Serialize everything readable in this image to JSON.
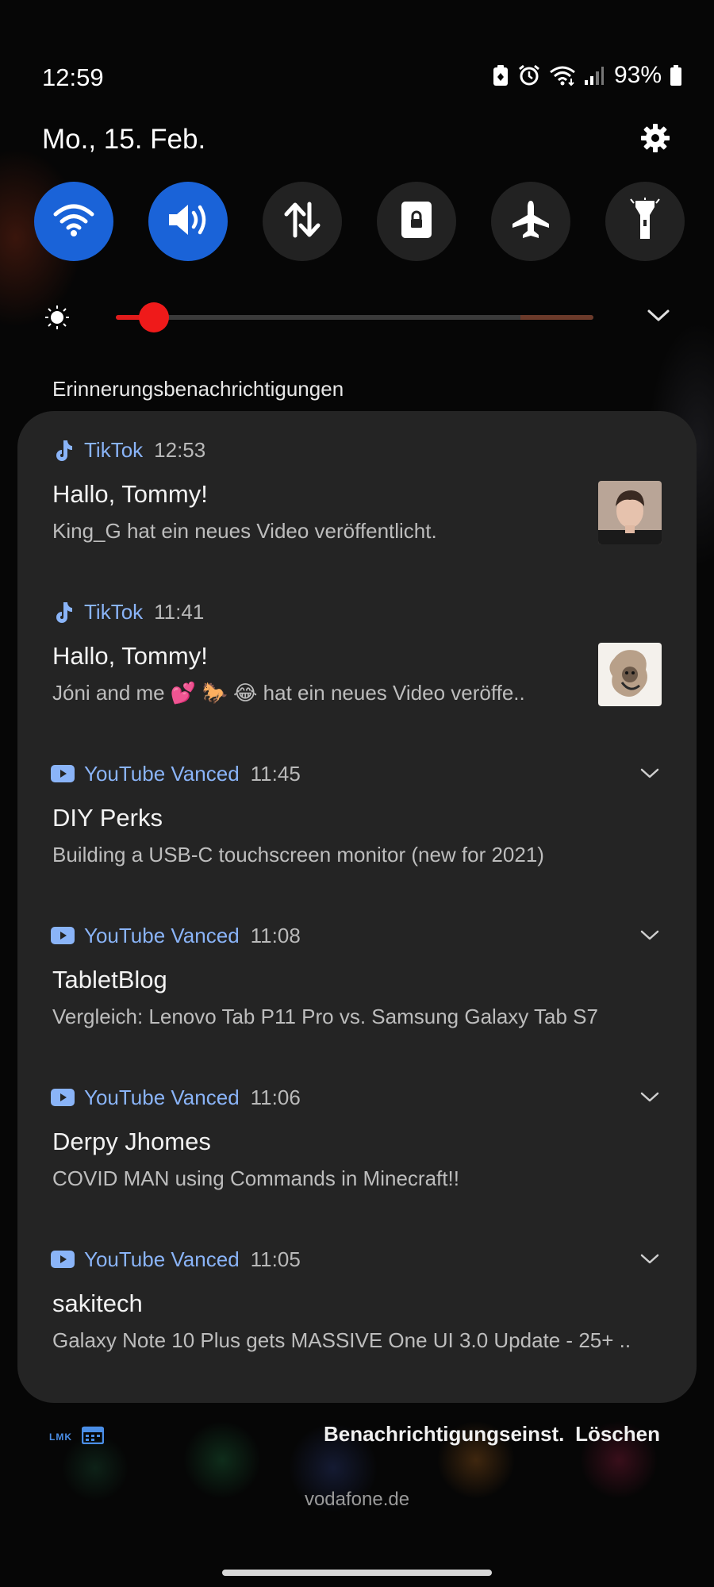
{
  "status_bar": {
    "time": "12:59",
    "battery_percent": "93%",
    "icons": [
      "battery-saver-icon",
      "alarm-icon",
      "wifi-icon",
      "signal-icon",
      "battery-icon"
    ]
  },
  "header": {
    "date": "Mo., 15. Feb.",
    "settings_icon": "gear-icon"
  },
  "quick_tiles": [
    {
      "name": "wifi",
      "icon": "wifi-icon",
      "active": true
    },
    {
      "name": "sound",
      "icon": "volume-icon",
      "active": true
    },
    {
      "name": "mobile-data",
      "icon": "data-transfer-icon",
      "active": false
    },
    {
      "name": "rotation-lock",
      "icon": "lock-icon",
      "active": false
    },
    {
      "name": "airplane-mode",
      "icon": "airplane-icon",
      "active": false
    },
    {
      "name": "flashlight",
      "icon": "flashlight-icon",
      "active": false
    }
  ],
  "brightness": {
    "level": 0.05,
    "colors": {
      "fill": "#e11b1b",
      "thumb": "#ef1a1a"
    }
  },
  "section_title": "Erinnerungsbenachrichtigungen",
  "notifications": [
    {
      "app": "TikTok",
      "time": "12:53",
      "title": "Hallo, Tommy!",
      "text": "King_G hat ein neues Video veröffentlicht.",
      "thumbnail": "portrait-photo",
      "expandable": false
    },
    {
      "app": "TikTok",
      "time": "11:41",
      "title": "Hallo, Tommy!",
      "text": "Jóni and me 💕 🐎 😂 hat ein neues Video veröffe..",
      "thumbnail": "drawing-photo",
      "expandable": false
    },
    {
      "app": "YouTube Vanced",
      "time": "11:45",
      "title": "DIY Perks",
      "text": "Building a USB-C touchscreen monitor (new for 2021)",
      "expandable": true
    },
    {
      "app": "YouTube Vanced",
      "time": "11:08",
      "title": "TabletBlog",
      "text": "Vergleich: Lenovo Tab P11 Pro vs. Samsung Galaxy Tab S7",
      "expandable": true
    },
    {
      "app": "YouTube Vanced",
      "time": "11:06",
      "title": "Derpy Jhomes",
      "text": "COVID MAN using Commands in Minecraft!!",
      "expandable": true
    },
    {
      "app": "YouTube Vanced",
      "time": "11:05",
      "title": "sakitech",
      "text": "Galaxy Note 10 Plus gets MASSIVE One UI 3.0 Update - 25+ ..",
      "expandable": true
    }
  ],
  "footer": {
    "lnk_label": "LMK",
    "settings_label": "Benachrichtigungseinst.",
    "clear_label": "Löschen",
    "carrier": "vodafone.de"
  },
  "colors": {
    "accent_blue": "#1a63d8",
    "app_name_blue": "#8ab4f8",
    "card_bg": "#242424"
  }
}
